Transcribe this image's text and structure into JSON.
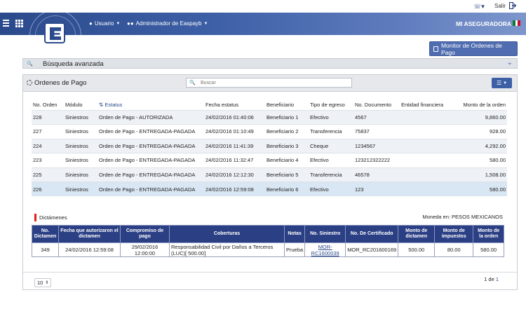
{
  "topbar": {
    "salir": "Salir",
    "phone_icon": "phone-icon",
    "exit_icon": "exit-icon"
  },
  "nav": {
    "user_label": "Usuario",
    "admin_label": "Administrador de Easpayb",
    "brand": "MI ASEGURADORA",
    "flag_colors": [
      "#0b7a3b",
      "#ffffff",
      "#c8102e"
    ]
  },
  "monitor_button": "Monitor de Ordenes de Pago",
  "search_bar": {
    "title": "Búsqueda avanzada"
  },
  "panel": {
    "title": "Ordenes de Pago",
    "search_placeholder": "Buscar",
    "columns": [
      "No. Orden",
      "Módulo",
      "Estatus",
      "Fecha estatus",
      "Beneficiario",
      "Tipo de egreso",
      "No. Documento",
      "Entidad financiera",
      "Monto de la orden"
    ],
    "rows": [
      {
        "orden": "228",
        "modulo": "Siniestros",
        "estatus": "Orden de Pago - AUTORIZADA",
        "fecha": "24/02/2016 01:40:06",
        "beneficiario": "Beneficiario 1",
        "tipo": "Efectivo",
        "documento": "4567",
        "entidad": "",
        "monto": "9,860.00"
      },
      {
        "orden": "227",
        "modulo": "Siniestros",
        "estatus": "Orden de Pago - ENTREGADA-PAGADA",
        "fecha": "24/02/2016 01:10:49",
        "beneficiario": "Beneficiario 2",
        "tipo": "Transferencia",
        "documento": "75837",
        "entidad": "",
        "monto": "928.00"
      },
      {
        "orden": "224",
        "modulo": "Siniestros",
        "estatus": "Orden de Pago - ENTREGADA-PAGADA",
        "fecha": "24/02/2016 11:41:39",
        "beneficiario": "Beneficiario 3",
        "tipo": "Cheque",
        "documento": "1234567",
        "entidad": "",
        "monto": "4,292.00"
      },
      {
        "orden": "223",
        "modulo": "Siniestros",
        "estatus": "Orden de Pago - ENTREGADA-PAGADA",
        "fecha": "24/02/2016 11:32:47",
        "beneficiario": "Beneficiario 4",
        "tipo": "Efectivo",
        "documento": "123212322222",
        "entidad": "",
        "monto": "580.00"
      },
      {
        "orden": "225",
        "modulo": "Siniestros",
        "estatus": "Orden de Pago - ENTREGADA-PAGADA",
        "fecha": "24/02/2016 12:12:30",
        "beneficiario": "Beneficiario 5",
        "tipo": "Transferencia",
        "documento": "46578",
        "entidad": "",
        "monto": "1,508.00"
      },
      {
        "orden": "226",
        "modulo": "Siniestros",
        "estatus": "Orden de Pago - ENTREGADA-PAGADA",
        "fecha": "24/02/2016 12:59:08",
        "beneficiario": "Beneficiario 6",
        "tipo": "Efectivo",
        "documento": "123",
        "entidad": "",
        "monto": "580.00"
      }
    ],
    "selected_row": 5
  },
  "dictamenes": {
    "label": "Dictámenes",
    "moneda": "Moneda en: PESOS MEXICANOS",
    "columns": [
      "No. Dictamen",
      "Fecha que autorizaron el dictamen",
      "Compromiso de pago",
      "Coberturas",
      "Notas",
      "No. Siniestro",
      "No. De Certificado",
      "Monto de dictamen",
      "Monto de impuestos",
      "Monto de la orden"
    ],
    "row": {
      "dictamen": "349",
      "fecha": "24/02/2016 12:59:08",
      "compromiso": "29/02/2016 12:00:00",
      "coberturas": "Responsabilidad Civil por Daños a Terceros (LUC)[ 500.00]",
      "notas": "Prueba",
      "siniestro": "MOR-RC1600039",
      "certificado": "MOR_RC201600169",
      "monto_dictamen": "500.00",
      "monto_impuestos": "80.00",
      "monto_orden": "580.00"
    }
  },
  "footer": {
    "page_size": "10",
    "pager_prefix": "1 de ",
    "pager_total": "1"
  }
}
